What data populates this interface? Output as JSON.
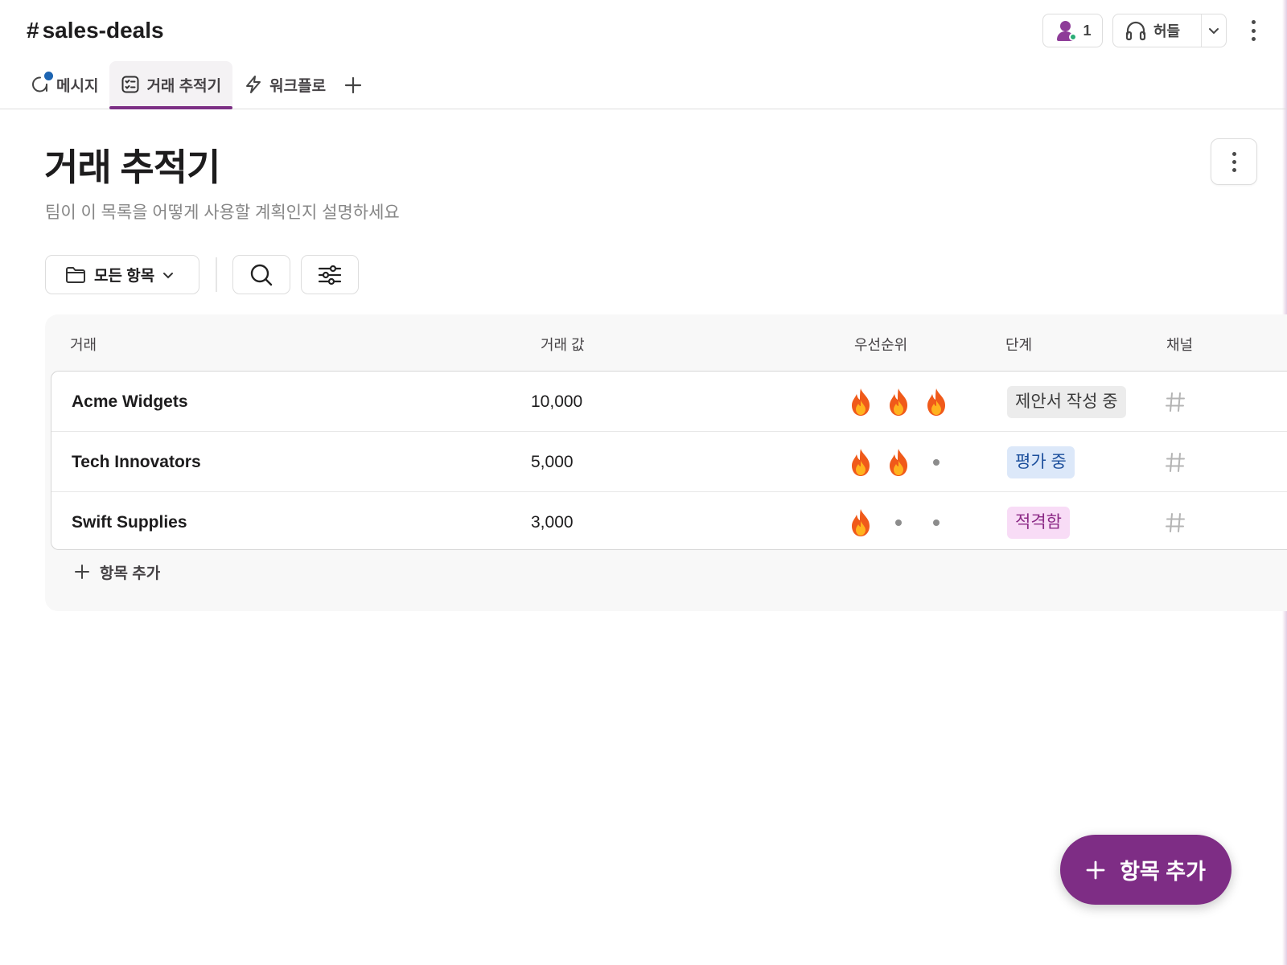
{
  "header": {
    "channel_hash": "#",
    "channel_name": "sales-deals",
    "member_count": "1",
    "huddle_label": "허들"
  },
  "tabs": [
    {
      "label": "메시지",
      "icon": "message-icon",
      "has_unread_dot": true
    },
    {
      "label": "거래 추적기",
      "icon": "list-icon",
      "active": true
    },
    {
      "label": "워크플로",
      "icon": "lightning-icon"
    }
  ],
  "page": {
    "title": "거래 추적기",
    "description": "팀이 이 목록을 어떻게 사용할 계획인지 설명하세요"
  },
  "toolbar": {
    "view_label": "모든 항목"
  },
  "table": {
    "columns": [
      "거래",
      "거래 값",
      "우선순위",
      "단계",
      "채널"
    ],
    "rows": [
      {
        "deal": "Acme Widgets",
        "value": "10,000",
        "priority": 3,
        "stage": "제안서 작성 중",
        "channel": "#"
      },
      {
        "deal": "Tech Innovators",
        "value": "5,000",
        "priority": 2,
        "stage": "평가 중",
        "channel": "#"
      },
      {
        "deal": "Swift Supplies",
        "value": "3,000",
        "priority": 1,
        "stage": "적격함",
        "channel": "#"
      }
    ],
    "add_row_label": "항목 추가"
  },
  "stage_colors": {
    "제안서 작성 중": {
      "bg": "#ececec",
      "fg": "#3a3a3a"
    },
    "평가 중": {
      "bg": "#dce8f9",
      "fg": "#1c4f9c"
    },
    "적격함": {
      "bg": "#f8dcf6",
      "fg": "#8c2a86"
    }
  },
  "fab": {
    "label": "항목 추가"
  },
  "colors": {
    "accent": "#7e2d85",
    "tab_indicator": "#7c3085",
    "presence": "#2bac76",
    "unread_dot": "#1d64b1"
  }
}
